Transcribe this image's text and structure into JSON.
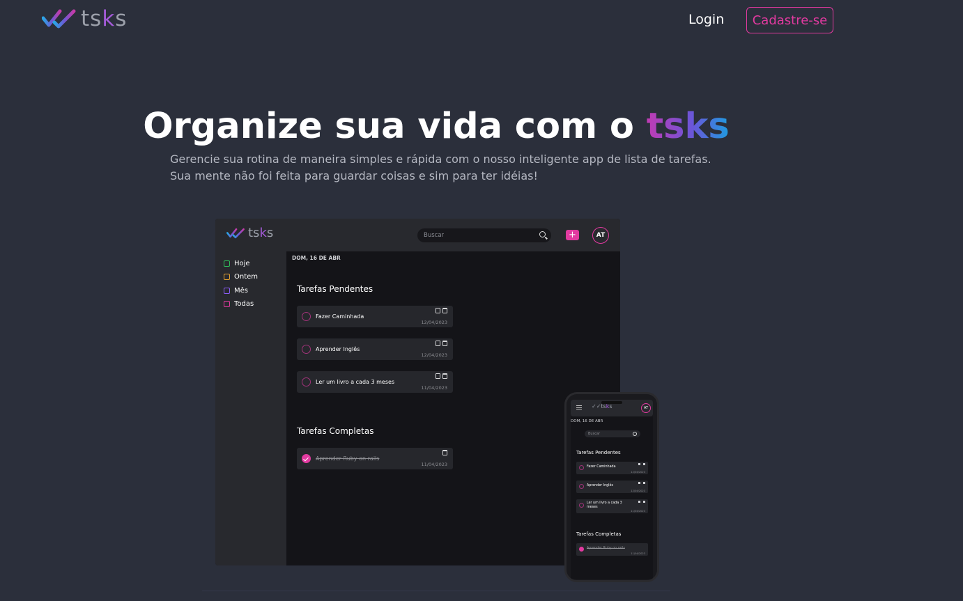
{
  "brand": {
    "name_prefix": "ts",
    "name_k": "k",
    "name_suffix": "s"
  },
  "nav": {
    "login_label": "Login",
    "signup_label": "Cadastre-se"
  },
  "hero": {
    "title_prefix": "Organize sua vida com o ",
    "title_brand": "tsks",
    "subtitle_line1": "Gerencie sua rotina de maneira simples e rápida com o nosso inteligente app de lista de tarefas.",
    "subtitle_line2": "Sua mente não foi feita para guardar coisas e sim para ter idéias!"
  },
  "colors": {
    "accent": "#e23aa0",
    "background": "#2b2f3b",
    "app_background": "#141418",
    "panel": "#28292e"
  },
  "desktop_app": {
    "search_placeholder": "Buscar",
    "add_icon": "+",
    "avatar_initials": "AT",
    "date_label": "DOM, 16 DE ABR",
    "sidebar": [
      {
        "label": "Hoje",
        "icon": "calendar-today-icon",
        "color": "#2fbf5a"
      },
      {
        "label": "Ontem",
        "icon": "calendar-yesterday-icon",
        "color": "#e3a12f"
      },
      {
        "label": "Mês",
        "icon": "calendar-month-icon",
        "color": "#8b5cf6"
      },
      {
        "label": "Todas",
        "icon": "grid-icon",
        "color": "#e23aa0"
      }
    ],
    "pending_title": "Tarefas Pendentes",
    "completed_title": "Tarefas Completas",
    "pending_tasks": [
      {
        "title": "Fazer Caminhada",
        "date": "12/04/2023"
      },
      {
        "title": "Aprender Inglês",
        "date": "12/04/2023"
      },
      {
        "title": "Ler um livro a cada 3 meses",
        "date": "11/04/2023"
      }
    ],
    "completed_tasks": [
      {
        "title": "Aprender Ruby on rails",
        "date": "11/04/2023"
      }
    ]
  },
  "mobile_app": {
    "avatar_initials": "AT",
    "date_label": "DOM, 16 DE ABR",
    "search_placeholder": "Buscar",
    "pending_title": "Tarefas Pendentes",
    "completed_title": "Tarefas Completas",
    "pending_tasks": [
      {
        "title": "Fazer Caminhada",
        "date": "12/04/2023"
      },
      {
        "title": "Aprender Inglês",
        "date": "12/04/2023"
      },
      {
        "title": "Ler um livro a cada 3 meses",
        "date": "11/04/2023"
      }
    ],
    "completed_tasks": [
      {
        "title": "Aprender Ruby on rails",
        "date": "11/04/2023"
      }
    ]
  }
}
